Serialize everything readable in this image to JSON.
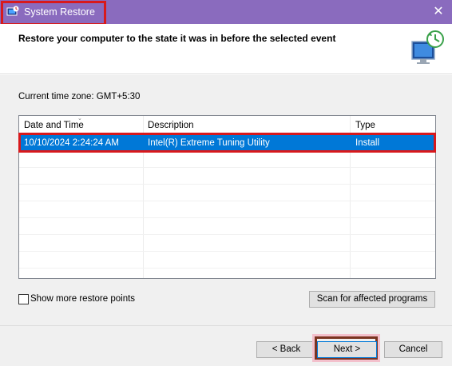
{
  "window": {
    "title": "System Restore",
    "close_glyph": "✕",
    "app_icon": "system-restore-icon",
    "titlebar_color": "#8a6bbe",
    "highlight_color": "#d8191c"
  },
  "header": {
    "heading": "Restore your computer to the state it was in before the selected event",
    "hero_icon": "monitor-restore-clock-icon"
  },
  "timezone": {
    "label": "Current time zone: GMT+5:30"
  },
  "table": {
    "columns": [
      "Date and Time",
      "Description",
      "Type"
    ],
    "sort_indicator": "⌄",
    "rows": [
      {
        "date": "10/10/2024 2:24:24 AM",
        "description": "Intel(R) Extreme Tuning Utility",
        "type": "Install",
        "selected": true
      }
    ],
    "selection_color": "#0078d7"
  },
  "options": {
    "show_more_label": "Show more restore points",
    "show_more_checked": false
  },
  "buttons": {
    "scan": "Scan for affected programs",
    "back": "< Back",
    "next": "Next >",
    "cancel": "Cancel"
  }
}
